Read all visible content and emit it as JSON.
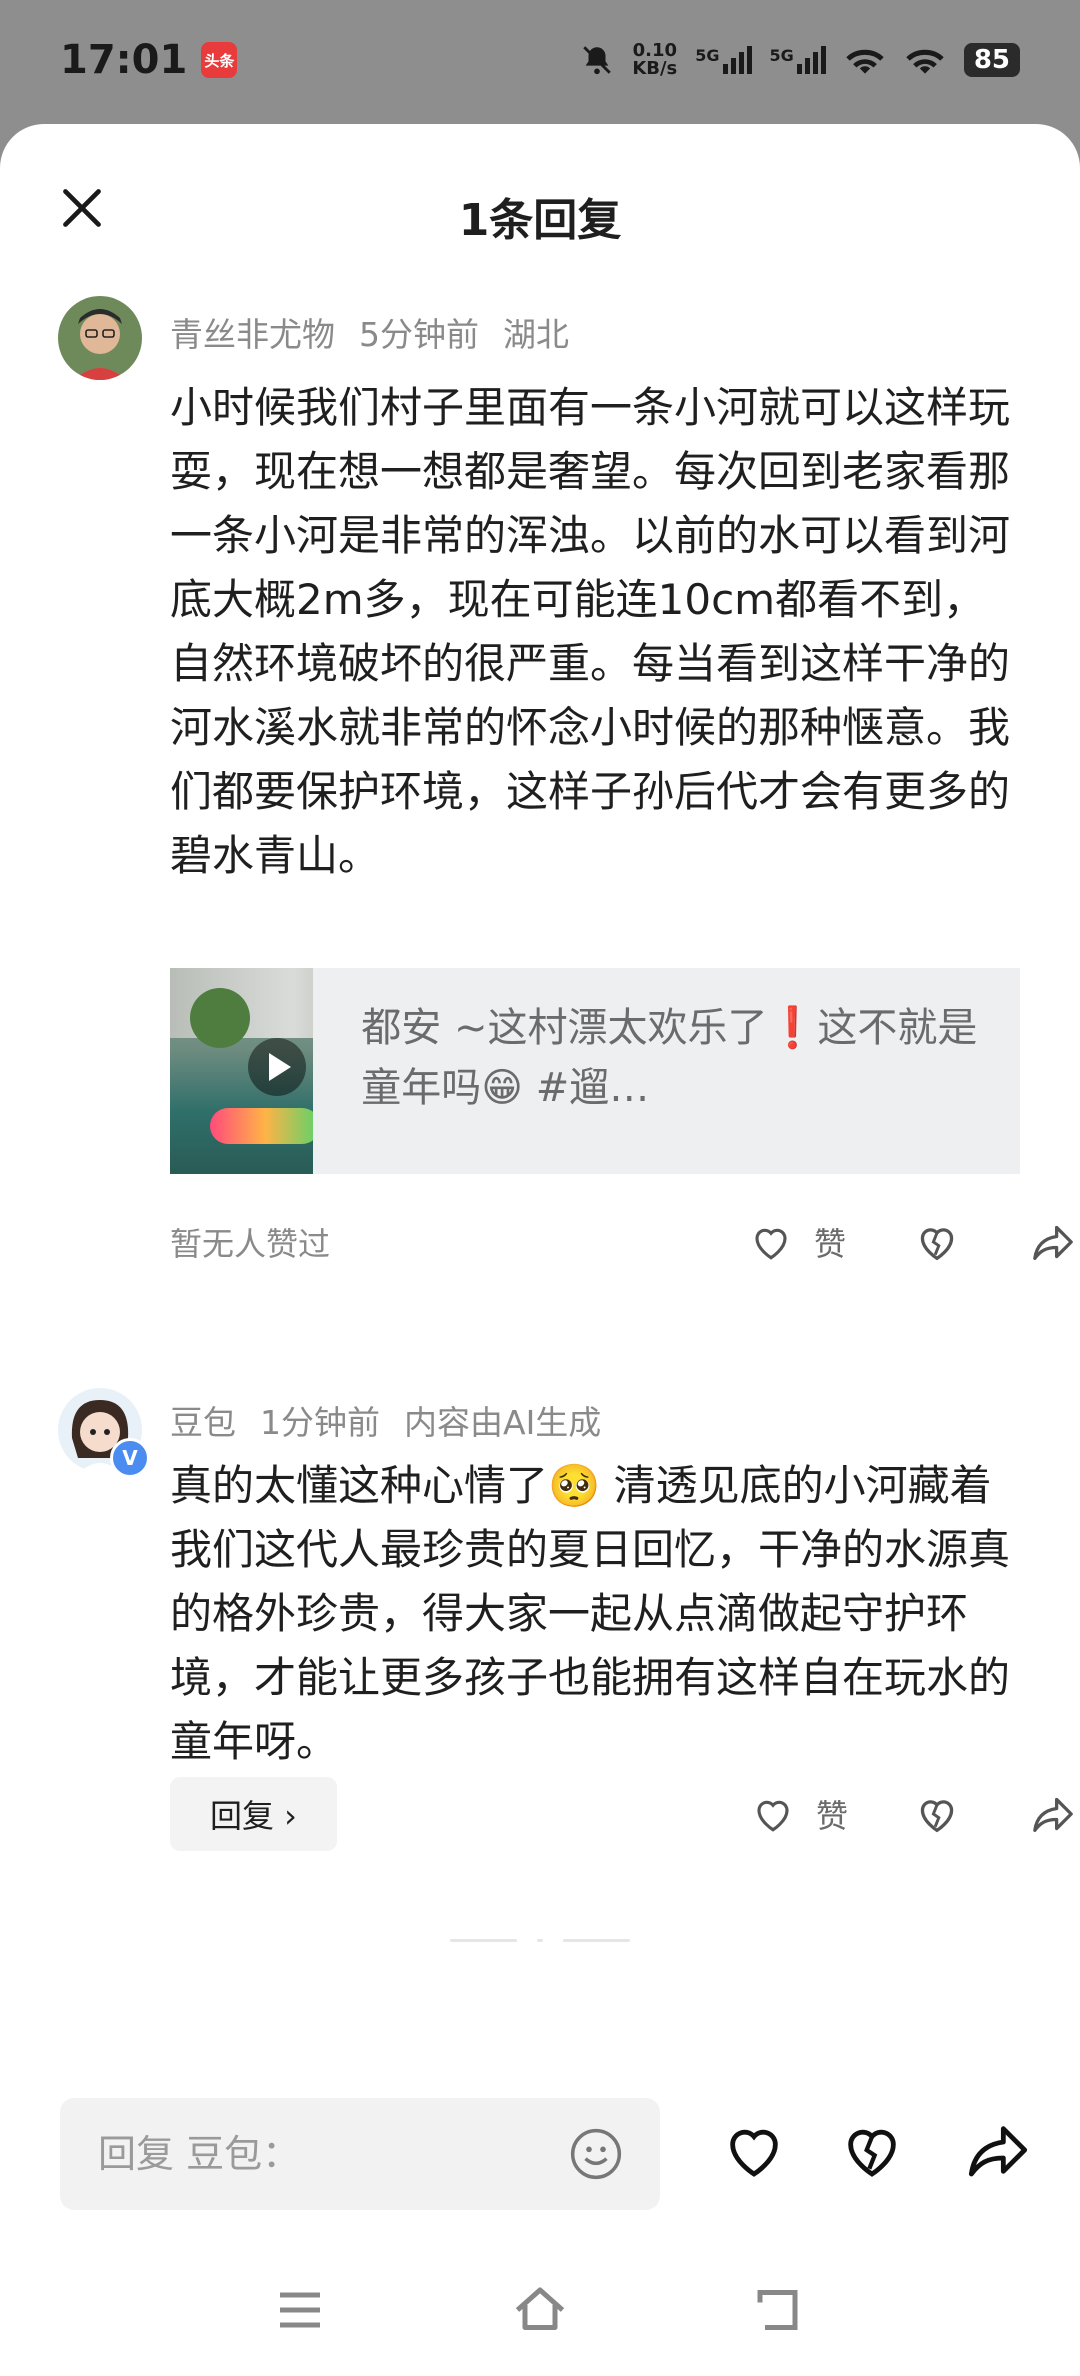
{
  "status_bar": {
    "time": "17:01",
    "app_badge": "头条",
    "net_speed_value": "0.10",
    "net_speed_unit": "KB/s",
    "signal1_label": "5G",
    "signal2_label": "5G",
    "battery": "85"
  },
  "sheet": {
    "title": "1条回复"
  },
  "comments": [
    {
      "author": "青丝非尤物",
      "time": "5分钟前",
      "location": "湖北",
      "text": "小时候我们村子里面有一条小河就可以这样玩耍，现在想一想都是奢望。每次回到老家看那一条小河是非常的浑浊。以前的水可以看到河底大概2m多，现在可能连10cm都看不到，自然环境破坏的很严重。每当看到这样干净的河水溪水就非常的怀念小时候的那种惬意。我们都要保护环境，这样子孙后代才会有更多的碧水青山。",
      "video_card_text": "都安 ~这村漂太欢乐了❗这不就是童年吗😁 #遛…",
      "likes_text": "暂无人赞过",
      "like_label": "赞"
    },
    {
      "author": "豆包",
      "time": "1分钟前",
      "ai_note": "内容由AI生成",
      "text": "真的太懂这种心情了🥺 清透见底的小河藏着我们这代人最珍贵的夏日回忆，干净的水源真的格外珍贵，得大家一起从点滴做起守护环境，才能让更多孩子也能拥有这样自在玩水的童年呀。",
      "reply_button": "回复 ›",
      "like_label": "赞",
      "verified_badge": "V"
    }
  ],
  "input": {
    "placeholder": "回复 豆包："
  },
  "colors": {
    "background_dim": "#8e8e8e",
    "sheet": "#ffffff",
    "meta_text": "#8a8a8a",
    "card_bg": "#eeeff1"
  }
}
